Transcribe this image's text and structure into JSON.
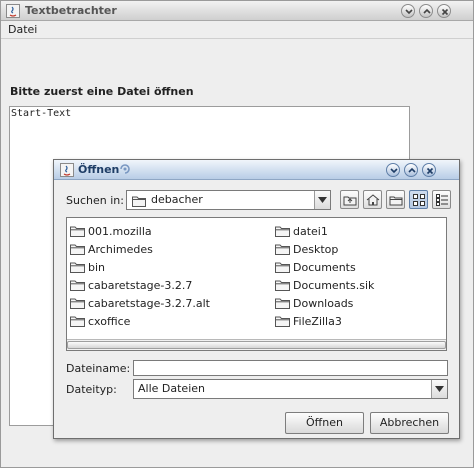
{
  "main_window": {
    "title": "Textbetrachter",
    "menu": {
      "datei": "Datei"
    },
    "prompt": "Bitte zuerst eine Datei öffnen",
    "text_area": {
      "content": "Start-Text"
    }
  },
  "dialog": {
    "title": "Öffnen",
    "look_in": {
      "label": "Suchen in:",
      "value": "debacher"
    },
    "toolbar_icons": [
      "up-folder-icon",
      "home-icon",
      "new-folder-icon",
      "list-view-icon",
      "details-view-icon"
    ],
    "files_left": [
      "001.mozilla",
      "Archimedes",
      "bin",
      "cabaretstage-3.2.7",
      "cabaretstage-3.2.7.alt",
      "cxoffice"
    ],
    "files_right": [
      "datei1",
      "Desktop",
      "Documents",
      "Documents.sik",
      "Downloads",
      "FileZilla3"
    ],
    "filename": {
      "label": "Dateiname:",
      "value": ""
    },
    "filetype": {
      "label": "Dateityp:",
      "value": "Alle Dateien"
    },
    "buttons": {
      "open": "Öffnen",
      "cancel": "Abbrechen"
    }
  }
}
